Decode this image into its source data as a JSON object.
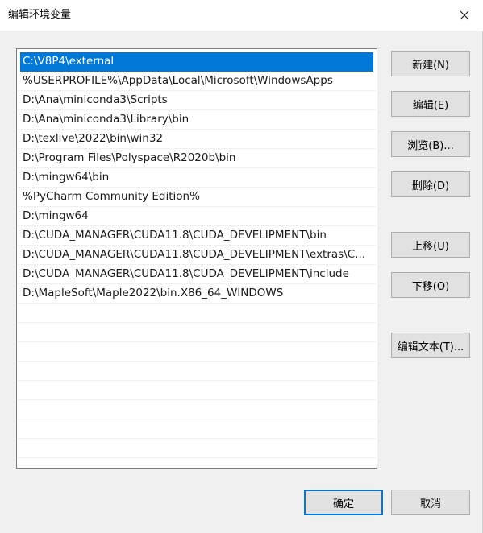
{
  "window": {
    "title": "编辑环境变量",
    "close_icon": "close-icon"
  },
  "paths": [
    "C:\\V8P4\\external",
    "%USERPROFILE%\\AppData\\Local\\Microsoft\\WindowsApps",
    "D:\\Ana\\miniconda3\\Scripts",
    "D:\\Ana\\miniconda3\\Library\\bin",
    "D:\\texlive\\2022\\bin\\win32",
    "D:\\Program Files\\Polyspace\\R2020b\\bin",
    "D:\\mingw64\\bin",
    "%PyCharm Community Edition%",
    "D:\\mingw64",
    "D:\\CUDA_MANAGER\\CUDA11.8\\CUDA_DEVELIPMENT\\bin",
    "D:\\CUDA_MANAGER\\CUDA11.8\\CUDA_DEVELIPMENT\\extras\\C...",
    "D:\\CUDA_MANAGER\\CUDA11.8\\CUDA_DEVELIPMENT\\include",
    "D:\\MapleSoft\\Maple2022\\bin.X86_64_WINDOWS"
  ],
  "selected_index": 0,
  "buttons": {
    "new": "新建(N)",
    "edit": "编辑(E)",
    "browse": "浏览(B)...",
    "delete": "删除(D)",
    "move_up": "上移(U)",
    "move_down": "下移(O)",
    "edit_text": "编辑文本(T)...",
    "ok": "确定",
    "cancel": "取消"
  },
  "colors": {
    "selection": "#0078d7",
    "dialog_bg": "#f0f0f0"
  }
}
